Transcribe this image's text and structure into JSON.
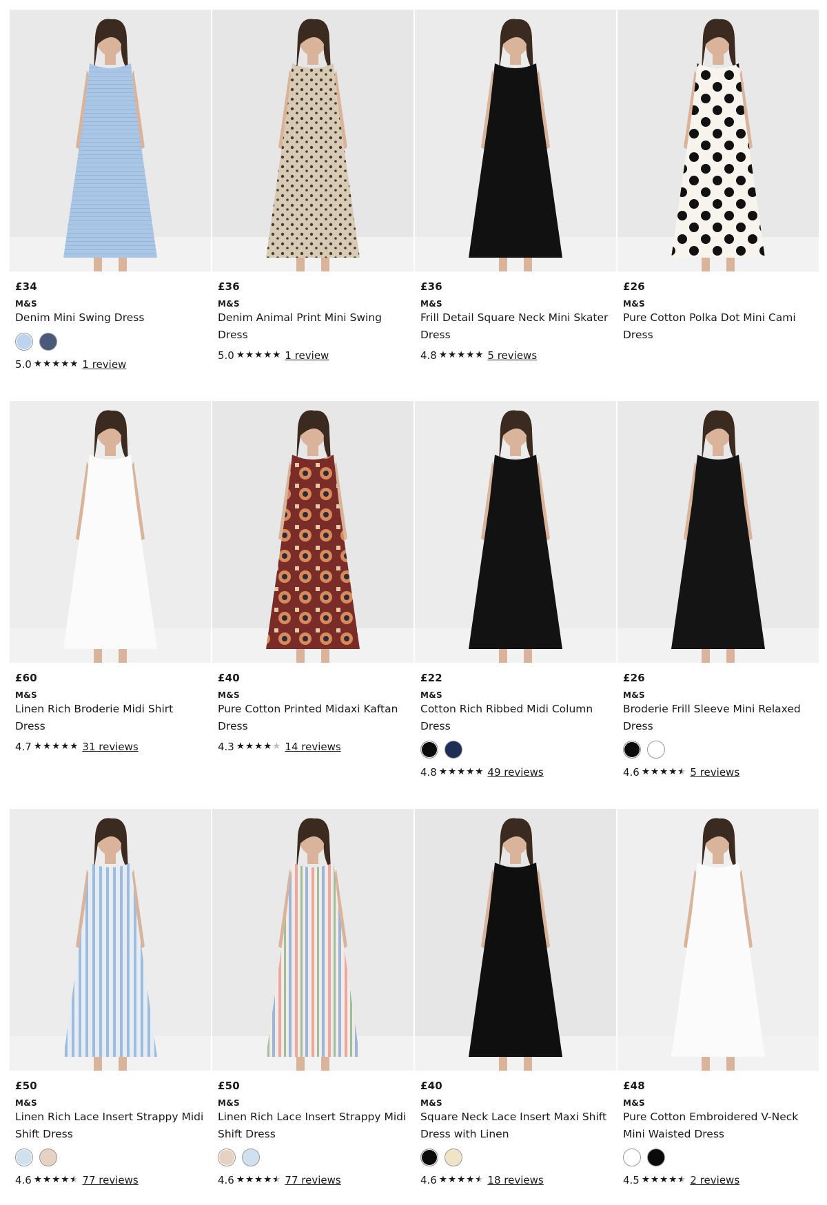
{
  "products": [
    {
      "price": "£34",
      "brand": "M&S",
      "title": "Denim Mini Swing Dress",
      "image": {
        "bg": "#e9e9e9",
        "garment": "#a9c6e6",
        "pattern": "denim",
        "subject": "woman-in-sleeveless-denim-mini-dress"
      },
      "swatches": [
        {
          "color": "#bcd4ee",
          "name": "light-denim"
        },
        {
          "color": "#4a5a7a",
          "name": "dark-denim"
        }
      ],
      "rating": {
        "score": "5.0",
        "stars": 5,
        "reviews": "1 review"
      }
    },
    {
      "price": "£36",
      "brand": "M&S",
      "title": "Denim Animal Print Mini Swing Dress",
      "image": {
        "bg": "#e6e6e6",
        "garment": "#d8cbb6",
        "pattern": "leopard",
        "subject": "woman-in-animal-print-mini-dress"
      },
      "swatches": [],
      "rating": {
        "score": "5.0",
        "stars": 5,
        "reviews": "1 review"
      }
    },
    {
      "price": "£36",
      "brand": "M&S",
      "title": "Frill Detail Square Neck Mini Skater Dress",
      "image": {
        "bg": "#ebebeb",
        "garment": "#111111",
        "pattern": "solid",
        "subject": "woman-in-black-skater-dress"
      },
      "swatches": [],
      "rating": {
        "score": "4.8",
        "stars": 5,
        "reviews": "5 reviews"
      }
    },
    {
      "price": "£26",
      "brand": "M&S",
      "title": "Pure Cotton Polka Dot Mini Cami Dress",
      "image": {
        "bg": "#e8e8e8",
        "garment": "#f7f4ee",
        "pattern": "polka",
        "subject": "woman-in-polka-dot-mini-dress"
      },
      "swatches": [],
      "rating": null
    },
    {
      "price": "£60",
      "brand": "M&S",
      "title": "Linen Rich Broderie Midi Shirt Dress",
      "image": {
        "bg": "#ededed",
        "garment": "#fbfbfb",
        "pattern": "solid",
        "subject": "woman-in-white-broderie-shirt-dress"
      },
      "swatches": [],
      "rating": {
        "score": "4.7",
        "stars": 5,
        "reviews": "31 reviews"
      }
    },
    {
      "price": "£40",
      "brand": "M&S",
      "title": "Pure Cotton Printed Midaxi Kaftan Dress",
      "image": {
        "bg": "#e7e7e7",
        "garment": "#a0483a",
        "pattern": "kaftan",
        "subject": "woman-in-printed-kaftan-dress"
      },
      "swatches": [],
      "rating": {
        "score": "4.3",
        "stars": 4,
        "reviews": "14 reviews"
      }
    },
    {
      "price": "£22",
      "brand": "M&S",
      "title": "Cotton Rich Ribbed Midi Column Dress",
      "image": {
        "bg": "#ececec",
        "garment": "#121212",
        "pattern": "solid",
        "subject": "woman-in-black-ribbed-midi-dress"
      },
      "swatches": [
        {
          "color": "#0b0b0b",
          "name": "black"
        },
        {
          "color": "#1e2e55",
          "name": "navy"
        }
      ],
      "rating": {
        "score": "4.8",
        "stars": 5,
        "reviews": "49 reviews"
      }
    },
    {
      "price": "£26",
      "brand": "M&S",
      "title": "Broderie Frill Sleeve Mini Relaxed Dress",
      "image": {
        "bg": "#e9e9e9",
        "garment": "#141414",
        "pattern": "solid",
        "subject": "woman-in-black-frill-sleeve-dress"
      },
      "swatches": [
        {
          "color": "#0b0b0b",
          "name": "black"
        },
        {
          "color": "#ffffff",
          "name": "white"
        }
      ],
      "rating": {
        "score": "4.6",
        "stars": 4.5,
        "reviews": "5 reviews"
      }
    },
    {
      "price": "£50",
      "brand": "M&S",
      "title": "Linen Rich Lace Insert Strappy Midi Shift Dress",
      "image": {
        "bg": "#ececec",
        "garment": "#bcd0e4",
        "pattern": "stripe-blue",
        "subject": "woman-in-blue-striped-strappy-dress"
      },
      "swatches": [
        {
          "color": "#cfe0ee",
          "name": "blue-stripe"
        },
        {
          "color": "#e6d2c2",
          "name": "multi-stripe"
        }
      ],
      "rating": {
        "score": "4.6",
        "stars": 4.5,
        "reviews": "77 reviews"
      }
    },
    {
      "price": "£50",
      "brand": "M&S",
      "title": "Linen Rich Lace Insert Strappy Midi Shift Dress",
      "image": {
        "bg": "#e9e9e9",
        "garment": "#f0e6dc",
        "pattern": "stripe-multi",
        "subject": "woman-in-multi-striped-strappy-dress"
      },
      "swatches": [
        {
          "color": "#e6d2c2",
          "name": "multi-stripe"
        },
        {
          "color": "#cfe0ee",
          "name": "blue-stripe"
        }
      ],
      "rating": {
        "score": "4.6",
        "stars": 4.5,
        "reviews": "77 reviews"
      }
    },
    {
      "price": "£40",
      "brand": "M&S",
      "title": "Square Neck Lace Insert Maxi Shift Dress with Linen",
      "image": {
        "bg": "#e6e6e6",
        "garment": "#0f0f0f",
        "pattern": "solid",
        "subject": "woman-in-black-maxi-dress"
      },
      "swatches": [
        {
          "color": "#0b0b0b",
          "name": "black"
        },
        {
          "color": "#efe4c8",
          "name": "cream"
        }
      ],
      "rating": {
        "score": "4.6",
        "stars": 4.5,
        "reviews": "18 reviews"
      }
    },
    {
      "price": "£48",
      "brand": "M&S",
      "title": "Pure Cotton Embroidered V-Neck Mini Waisted Dress",
      "image": {
        "bg": "#efefef",
        "garment": "#fbfbfb",
        "pattern": "solid",
        "subject": "woman-in-white-embroidered-mini-dress"
      },
      "swatches": [
        {
          "color": "#ffffff",
          "name": "white"
        },
        {
          "color": "#0b0b0b",
          "name": "black"
        }
      ],
      "rating": {
        "score": "4.5",
        "stars": 4.5,
        "reviews": "2 reviews"
      }
    }
  ]
}
